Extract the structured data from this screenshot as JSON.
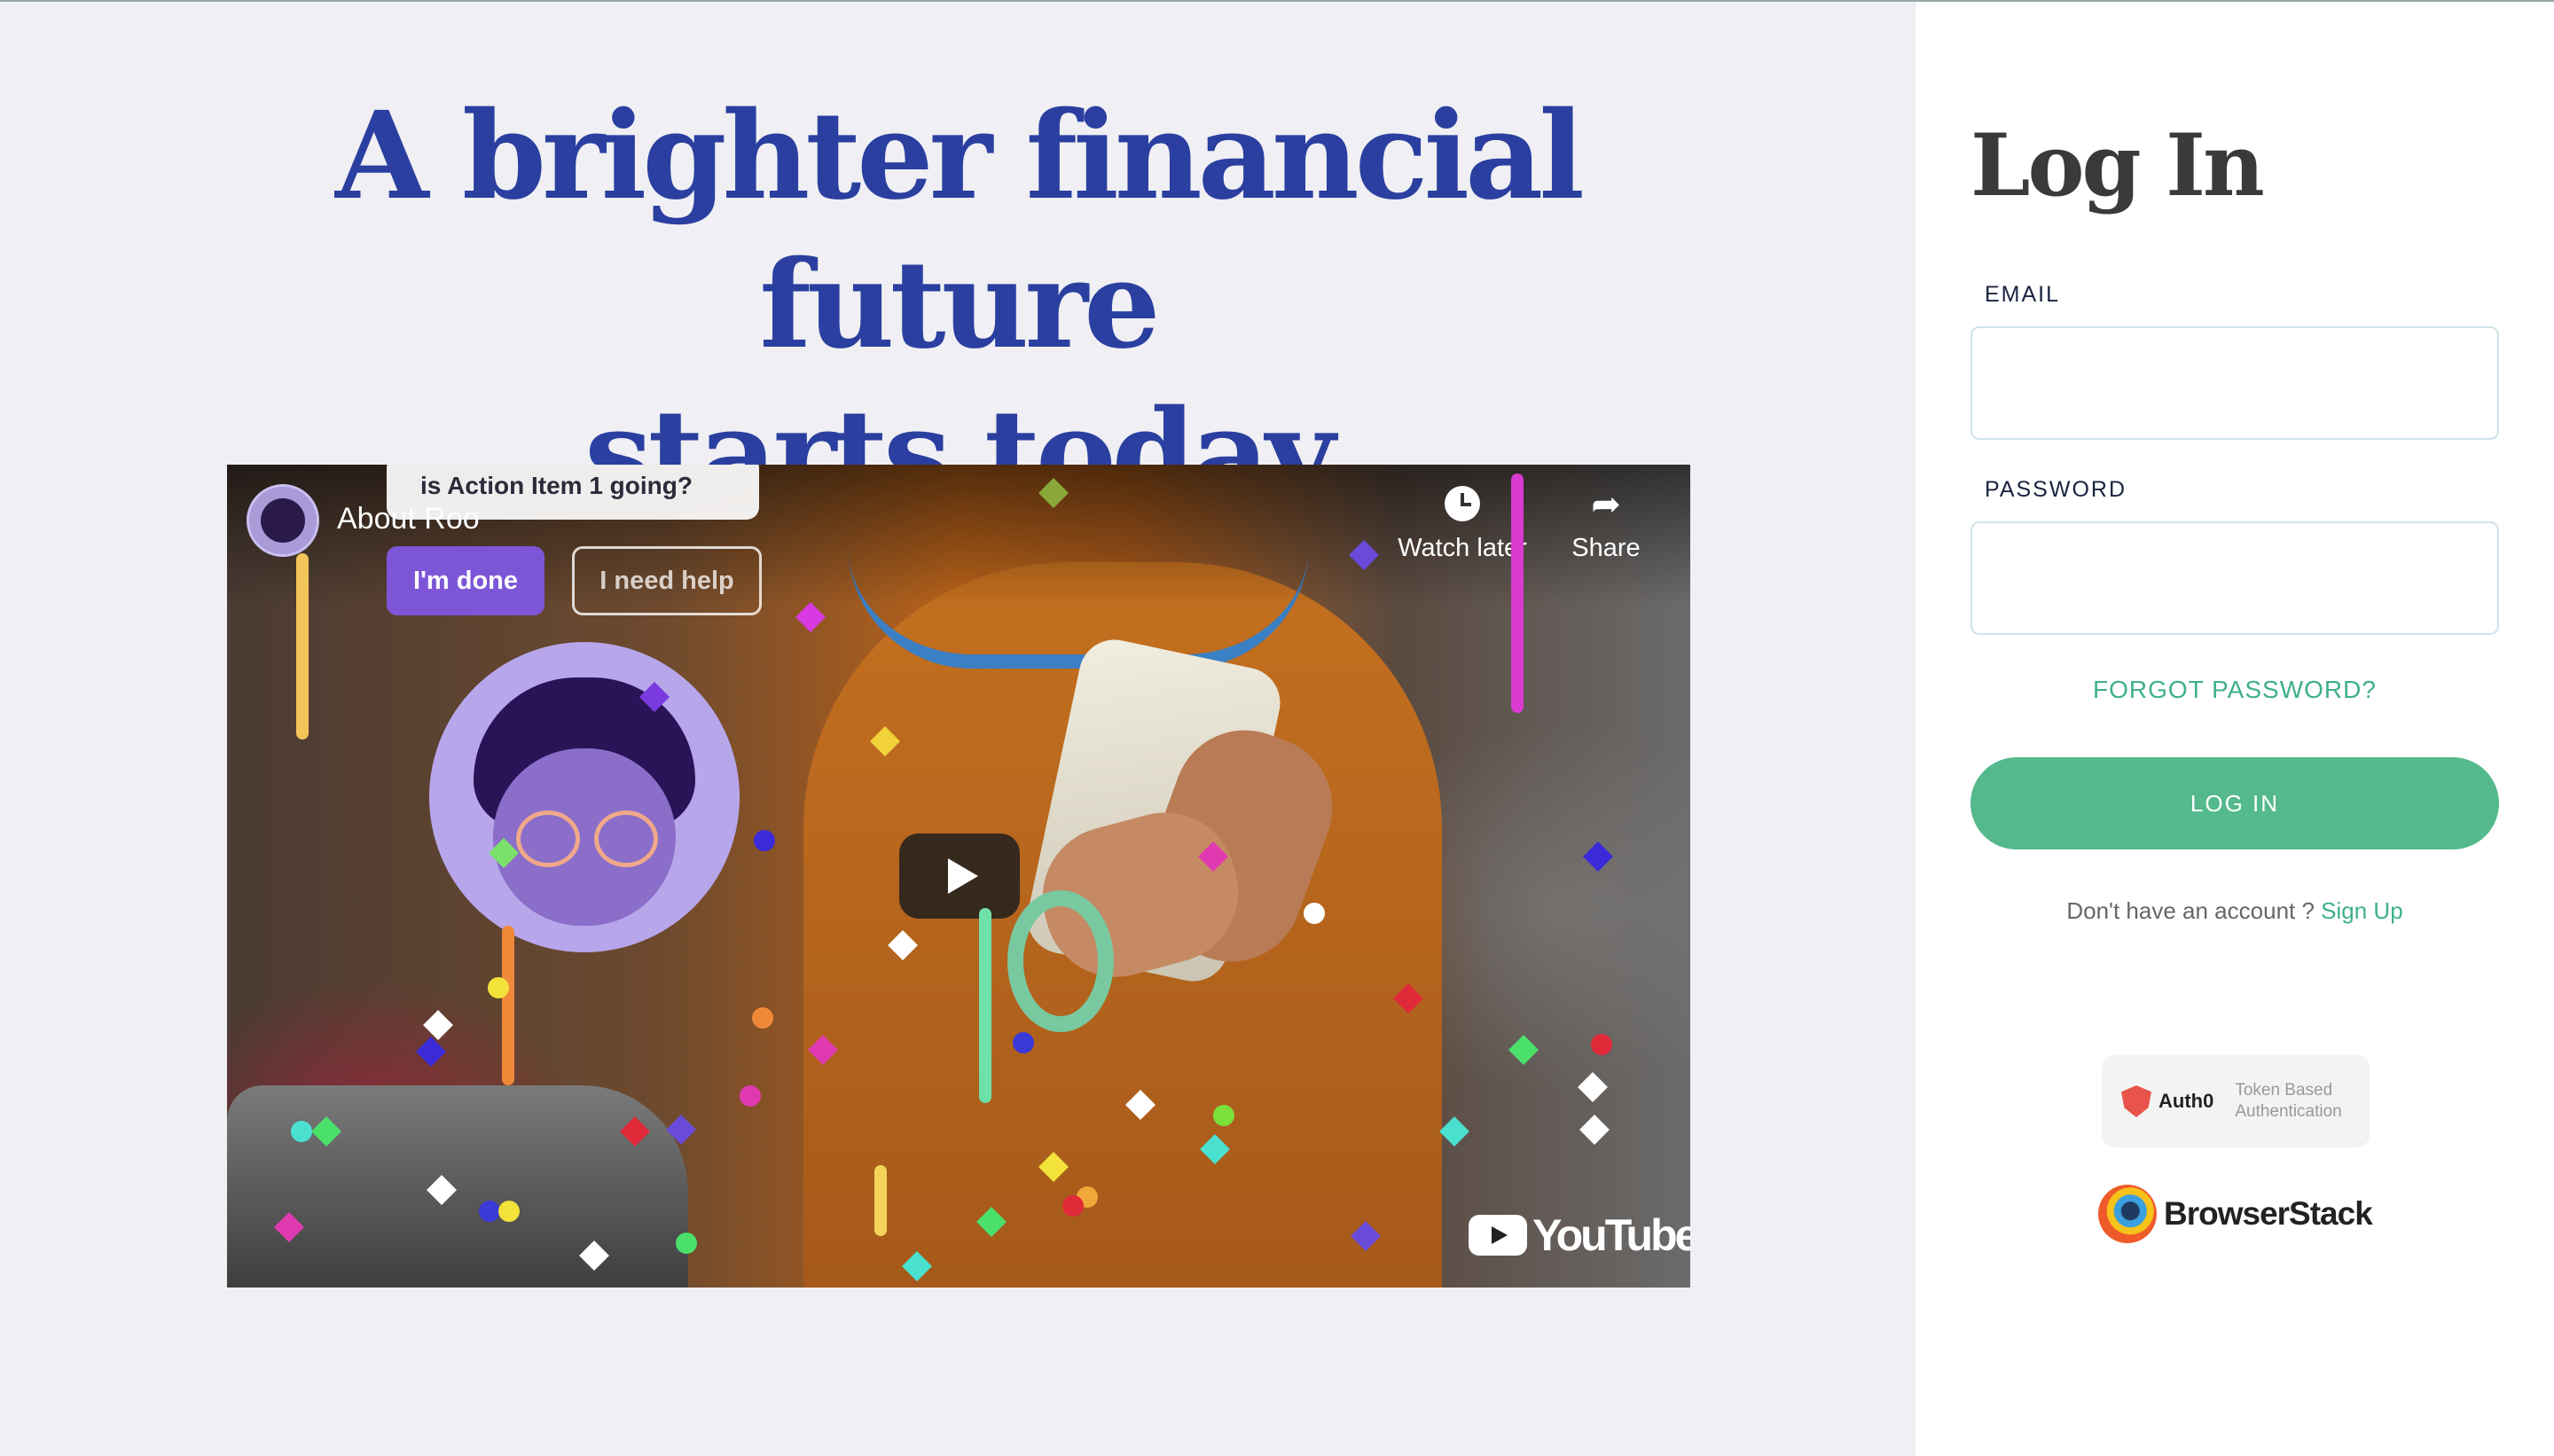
{
  "hero": {
    "headline_line1": "A brighter financial future",
    "headline_line2": "starts today"
  },
  "video": {
    "channel_avatar_icon": "roo-avatar",
    "title": "About Roo",
    "bubble_text": "is Action Item 1 going?",
    "done_button": "I'm done",
    "help_button": "I need help",
    "watch_later_label": "Watch later",
    "watch_later_icon": "clock-icon",
    "share_label": "Share",
    "share_icon": "share-arrow-icon",
    "play_icon": "play-icon",
    "logo_text": "YouTube"
  },
  "login": {
    "title": "Log In",
    "email_label": "EMAIL",
    "email_value": "",
    "password_label": "PASSWORD",
    "password_value": "",
    "forgot_link": "FORGOT PASSWORD?",
    "submit_label": "LOG IN",
    "signup_prompt": "Don't have an account ?",
    "signup_link": "Sign Up"
  },
  "badges": {
    "auth0_name": "Auth0",
    "auth0_desc_line1": "Token Based",
    "auth0_desc_line2": "Authentication",
    "browserstack_name": "BrowserStack"
  },
  "colors": {
    "headline": "#2a3f9f",
    "accent_green": "#54b98c",
    "link_green": "#3fb088",
    "page_bg": "#efeff4"
  }
}
